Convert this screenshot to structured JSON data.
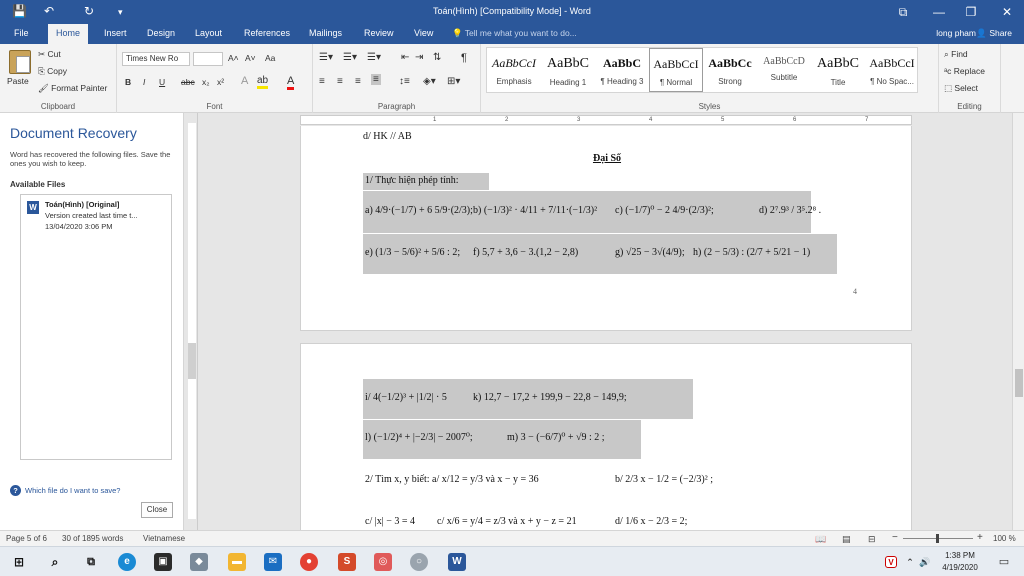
{
  "titlebar": {
    "title": "Toán(Hình) [Compatibility Mode] - Word",
    "controls": {
      "ribbon_display": "⧉",
      "minimize": "—",
      "restore": "❐",
      "close": "✕"
    }
  },
  "quick_access": {
    "save": "💾",
    "undo": "↶",
    "redo": "↻",
    "customize": "▾"
  },
  "tabs": [
    {
      "label": "File"
    },
    {
      "label": "Home"
    },
    {
      "label": "Insert"
    },
    {
      "label": "Design"
    },
    {
      "label": "Layout"
    },
    {
      "label": "References"
    },
    {
      "label": "Mailings"
    },
    {
      "label": "Review"
    },
    {
      "label": "View"
    }
  ],
  "tell_me": "Tell me what you want to do...",
  "account": {
    "user": "long pham",
    "share": "Share"
  },
  "ribbon": {
    "clipboard": {
      "paste": "Paste",
      "cut": "Cut",
      "copy": "Copy",
      "format_painter": "Format Painter",
      "label": "Clipboard"
    },
    "font": {
      "name": "Times New Ro",
      "label": "Font",
      "bold": "B",
      "italic": "I",
      "underline": "U",
      "strike": "abc",
      "sub": "x₂",
      "sup": "x²",
      "grow": "A˄",
      "shrink": "A˅",
      "case": "Aa"
    },
    "paragraph": {
      "label": "Paragraph",
      "pilcrow": "¶"
    },
    "styles": {
      "label": "Styles",
      "items": [
        {
          "sample": "AaBbCcI",
          "name": "Emphasis"
        },
        {
          "sample": "AaBbC",
          "name": "Heading 1"
        },
        {
          "sample": "AaBbC",
          "name": "¶ Heading 3"
        },
        {
          "sample": "AaBbCcI",
          "name": "¶ Normal"
        },
        {
          "sample": "AaBbCc",
          "name": "Strong"
        },
        {
          "sample": "AaBbCcD",
          "name": "Subtitle"
        },
        {
          "sample": "AaBbC",
          "name": "Title"
        },
        {
          "sample": "AaBbCcI",
          "name": "¶ No Spac..."
        }
      ]
    },
    "editing": {
      "find": "Find",
      "replace": "Replace",
      "select": "Select",
      "label": "Editing"
    }
  },
  "recovery": {
    "title": "Document Recovery",
    "description": "Word has recovered the following files. Save the ones you wish to keep.",
    "available_label": "Available Files",
    "file": {
      "name": "Toán(Hình)  [Original]",
      "version": "Version created last time t...",
      "date": "13/04/2020 3:06 PM"
    },
    "help_link": "Which file do I want to save?",
    "close_label": "Close"
  },
  "ruler_numbers": [
    "1",
    "2",
    "3",
    "4",
    "5",
    "6",
    "7"
  ],
  "document": {
    "page1": {
      "prev_line": "d/ HK // AB",
      "section": "Đại Số",
      "task1": "1/ Thực hiện phép tính:",
      "row_a": "a) 4/9·(−1/7) + 6 5/9·(2/3);",
      "row_b": "b) (−1/3)² · 4/11 + 7/11·(−1/3)²",
      "row_c": "c) (−1/7)⁰ − 2 4/9·(2/3)²;",
      "row_d": "d) 2⁷.9³ / 3⁵.2⁸ .",
      "row_e": "e) (1/3 − 5/6)² + 5/6 : 2;",
      "row_f": "f) 5,7 + 3,6 − 3.(1,2 − 2,8)",
      "row_g": "g) √25 − 3√(4/9);",
      "row_h": "h) (2 − 5/3) : (2/7 + 5/21 − 1)",
      "page_number": "4"
    },
    "page2": {
      "row_i": "i/ 4(−1/2)³ + |1/2| · 5",
      "row_k": "k) 12,7 − 17,2 + 199,9 − 22,8 − 149,9;",
      "row_l": "l) (−1/2)⁴ + |−2/3| − 2007⁰;",
      "row_m": "m) 3 − (−6/7)⁰ + √9 : 2 ;",
      "task2": "2/ Tìm x, y biết: a/ x/12 = y/3  và  x − y = 36",
      "task2_b": "b/ 2/3 x − 1/2 = (−2/3)² ;",
      "row_c2": "c/ |x| − 3 = 4",
      "row_c3": "c/ x/6 = y/4 = z/3  và  x + y − z = 21",
      "row_d2": "d/ 1/6 x − 2/3 = 2;"
    }
  },
  "status": {
    "page": "Page 5 of 6",
    "words": "30 of 1895 words",
    "language": "Vietnamese",
    "zoom": "100 %"
  },
  "taskbar": {
    "time": "1:38 PM",
    "date": "4/19/2020"
  }
}
